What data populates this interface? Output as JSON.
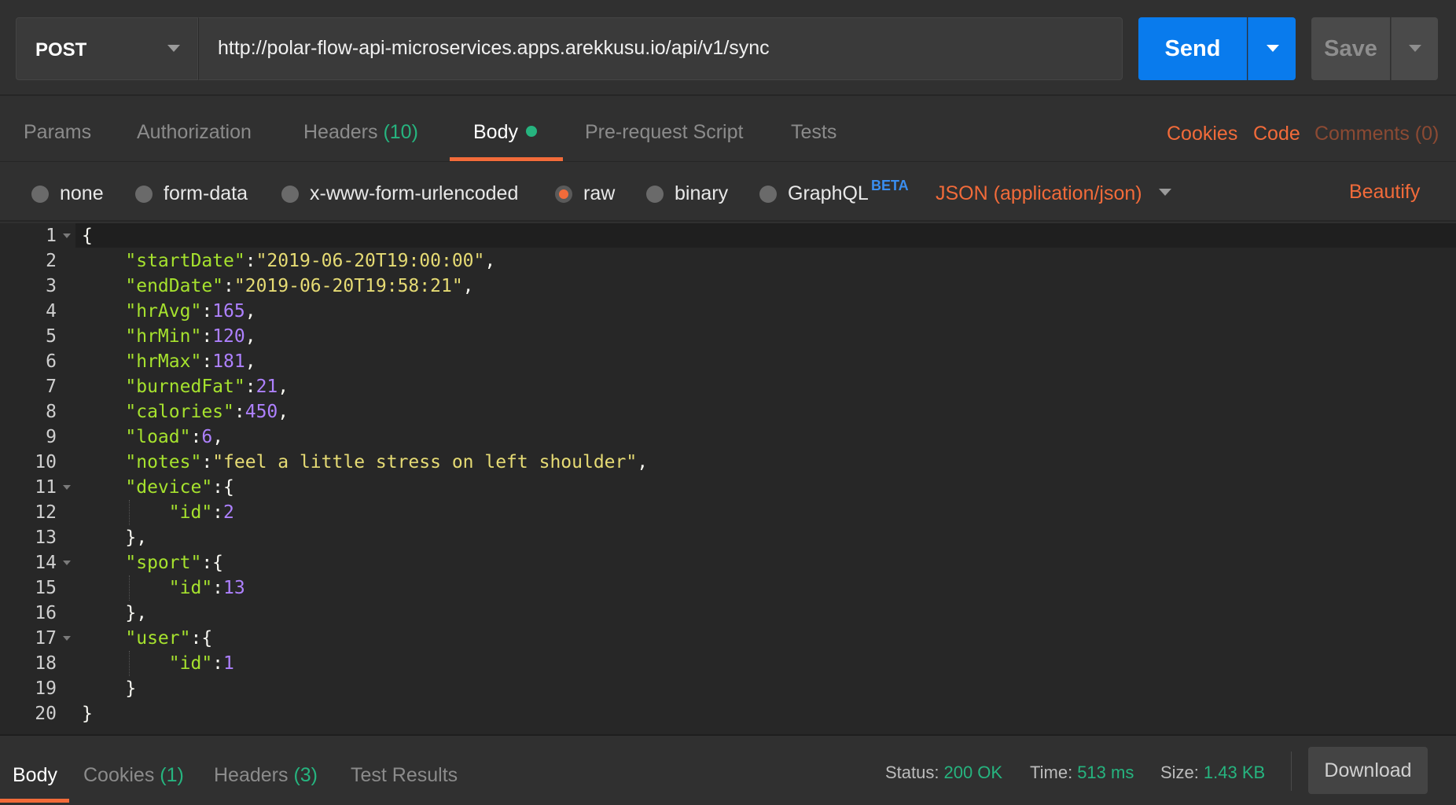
{
  "request": {
    "method": "POST",
    "url": "http://polar-flow-api-microservices.apps.arekkusu.io/api/v1/sync",
    "send_label": "Send",
    "save_label": "Save"
  },
  "tabs": {
    "params": "Params",
    "authorization": "Authorization",
    "headers": "Headers",
    "headers_count": "(10)",
    "body": "Body",
    "pre_request": "Pre-request Script",
    "tests": "Tests",
    "cookies": "Cookies",
    "code": "Code",
    "comments": "Comments (0)"
  },
  "body_types": {
    "none": "none",
    "form_data": "form-data",
    "urlencoded": "x-www-form-urlencoded",
    "raw": "raw",
    "binary": "binary",
    "graphql": "GraphQL",
    "beta": "BETA",
    "selected": "raw",
    "content_type": "JSON (application/json)",
    "beautify": "Beautify"
  },
  "editor": {
    "line_numbers": [
      "1",
      "2",
      "3",
      "4",
      "5",
      "6",
      "7",
      "8",
      "9",
      "10",
      "11",
      "12",
      "13",
      "14",
      "15",
      "16",
      "17",
      "18",
      "19",
      "20"
    ],
    "startDate_key": "\"startDate\"",
    "startDate_val": "\"2019-06-20T19:00:00\"",
    "endDate_key": "\"endDate\"",
    "endDate_val": "\"2019-06-20T19:58:21\"",
    "hrAvg_key": "\"hrAvg\"",
    "hrAvg_val": "165",
    "hrMin_key": "\"hrMin\"",
    "hrMin_val": "120",
    "hrMax_key": "\"hrMax\"",
    "hrMax_val": "181",
    "burnedFat_key": "\"burnedFat\"",
    "burnedFat_val": "21",
    "calories_key": "\"calories\"",
    "calories_val": "450",
    "load_key": "\"load\"",
    "load_val": "6",
    "notes_key": "\"notes\"",
    "notes_val": "\"feel a little stress on left shoulder\"",
    "device_key": "\"device\"",
    "device_id_key": "\"id\"",
    "device_id_val": "2",
    "sport_key": "\"sport\"",
    "sport_id_key": "\"id\"",
    "sport_id_val": "13",
    "user_key": "\"user\"",
    "user_id_key": "\"id\"",
    "user_id_val": "1"
  },
  "response": {
    "body": "Body",
    "cookies": "Cookies",
    "cookies_count": "(1)",
    "headers": "Headers",
    "headers_count": "(3)",
    "test_results": "Test Results",
    "status_label": "Status:",
    "status_value": "200 OK",
    "time_label": "Time:",
    "time_value": "513 ms",
    "size_label": "Size:",
    "size_value": "1.43 KB",
    "download": "Download"
  },
  "colors": {
    "accent_orange": "#f26b3a",
    "send_blue": "#097bed",
    "ok_green": "#26b47f"
  }
}
